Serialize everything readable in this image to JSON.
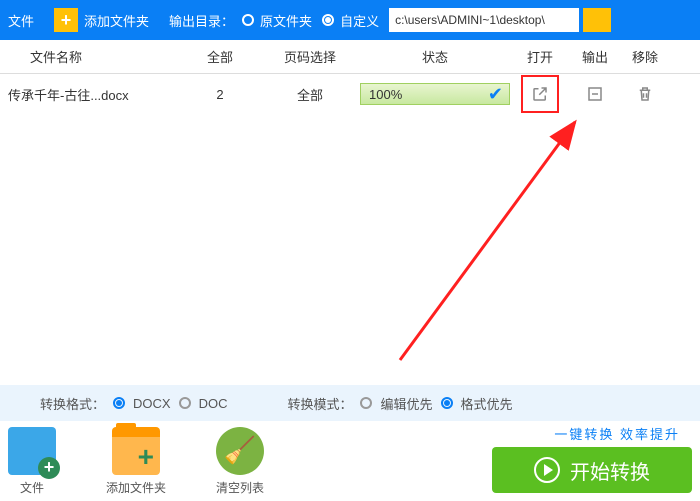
{
  "toolbar": {
    "file_label": "文件",
    "add_folder_label": "添加文件夹",
    "output_dir_label": "输出目录：",
    "radio_original": "原文件夹",
    "radio_custom": "自定义",
    "path_value": "c:\\users\\ADMINI~1\\desktop\\"
  },
  "headers": {
    "name": "文件名称",
    "all": "全部",
    "page": "页码选择",
    "status": "状态",
    "open": "打开",
    "output": "输出",
    "remove": "移除"
  },
  "row": {
    "filename": "传承千年-古往...docx",
    "count": "2",
    "page_sel": "全部",
    "progress": "100%"
  },
  "settings": {
    "format_label": "转换格式：",
    "docx": "DOCX",
    "doc": "DOC",
    "mode_label": "转换模式：",
    "edit_priority": "编辑优先",
    "format_priority": "格式优先"
  },
  "actions": {
    "file_label": "文件",
    "add_folder_label": "添加文件夹",
    "clear_list_label": "清空列表"
  },
  "slogan": "一键转换  效率提升",
  "start_button": "开始转换"
}
